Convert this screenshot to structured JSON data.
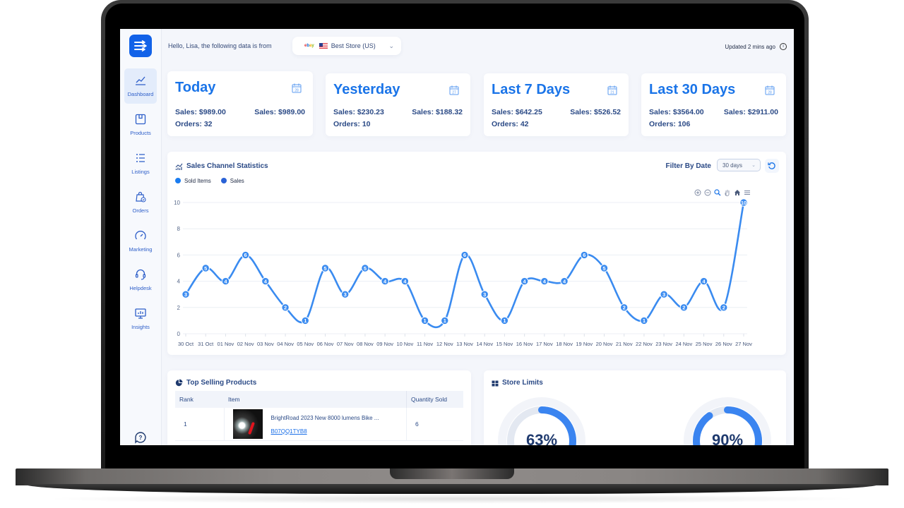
{
  "greeting": "Hello, Lisa, the following data is from",
  "store_selector": {
    "marketplace": "ebay",
    "flag": "us-flag",
    "store": "Best Store (US)"
  },
  "updated": "Updated 2 mins ago",
  "sidebar": {
    "items": [
      {
        "label": "Dashboard",
        "icon": "chart-line-icon",
        "active": true
      },
      {
        "label": "Products",
        "icon": "box-icon"
      },
      {
        "label": "Listings",
        "icon": "list-icon"
      },
      {
        "label": "Orders",
        "icon": "shopping-bag-icon"
      },
      {
        "label": "Marketing",
        "icon": "speedometer-icon"
      },
      {
        "label": "Helpdesk",
        "icon": "headset-icon"
      },
      {
        "label": "Insights",
        "icon": "monitor-chart-icon"
      }
    ],
    "help_icon": "help-icon"
  },
  "stats": [
    {
      "title": "Today",
      "calendar_day": "28",
      "sales_left": "Sales: $989.00",
      "sales_right": "Sales: $989.00",
      "orders": "Orders: 32"
    },
    {
      "title": "Yesterday",
      "calendar_day": "27",
      "sales_left": "Sales: $230.23",
      "sales_right": "Sales: $188.32",
      "orders": "Orders: 10"
    },
    {
      "title": "Last 7 Days",
      "calendar_day": "21",
      "sales_left": "Sales: $642.25",
      "sales_right": "Sales: $526.52",
      "orders": "Orders: 42"
    },
    {
      "title": "Last 30 Days",
      "calendar_day": "28",
      "sales_left": "Sales: $3564.00",
      "sales_right": "Sales: $2911.00",
      "orders": "Orders: 106"
    }
  ],
  "sales_channel": {
    "title": "Sales Channel Statistics",
    "filter_label": "Filter By Date",
    "filter_value": "30 days"
  },
  "chart_data": {
    "type": "line",
    "title": "Sales Channel Statistics",
    "legend": [
      {
        "name": "Sold Items",
        "color": "#1a7cf0"
      },
      {
        "name": "Sales",
        "color": "#2a62d6"
      }
    ],
    "legend_position": "top-left",
    "x": [
      "30 Oct",
      "31 Oct",
      "01 Nov",
      "02 Nov",
      "03 Nov",
      "04 Nov",
      "05 Nov",
      "06 Nov",
      "07 Nov",
      "08 Nov",
      "09 Nov",
      "10 Nov",
      "11 Nov",
      "12 Nov",
      "13 Nov",
      "14 Nov",
      "15 Nov",
      "16 Nov",
      "17 Nov",
      "18 Nov",
      "19 Nov",
      "20 Nov",
      "21 Nov",
      "22 Nov",
      "23 Nov",
      "24 Nov",
      "25 Nov",
      "26 Nov",
      "27 Nov"
    ],
    "series": [
      {
        "name": "Sold Items",
        "values": [
          3,
          5,
          4,
          6,
          4,
          2,
          1,
          5,
          3,
          5,
          4,
          4,
          1,
          1,
          6,
          3,
          1,
          4,
          4,
          4,
          6,
          5,
          2,
          1,
          3,
          2,
          4,
          2,
          10
        ]
      }
    ],
    "yticks": [
      0,
      2,
      4,
      6,
      8,
      10
    ],
    "ylim": [
      0,
      10
    ],
    "grid": true,
    "line_color": "#3a8bf0"
  },
  "top_selling": {
    "title": "Top Selling Products",
    "columns": [
      "Rank",
      "Item",
      "Quantity Sold"
    ],
    "rows": [
      {
        "rank": "1",
        "title": "BrightRoad 2023 New 8000 lumens Bike ...",
        "sku": "B07QQ1TYB8",
        "qty": "6"
      }
    ]
  },
  "store_limits": {
    "title": "Store Limits",
    "gauges": [
      {
        "percent": 63,
        "label": "63%"
      },
      {
        "percent": 90,
        "label": "90%"
      }
    ]
  }
}
